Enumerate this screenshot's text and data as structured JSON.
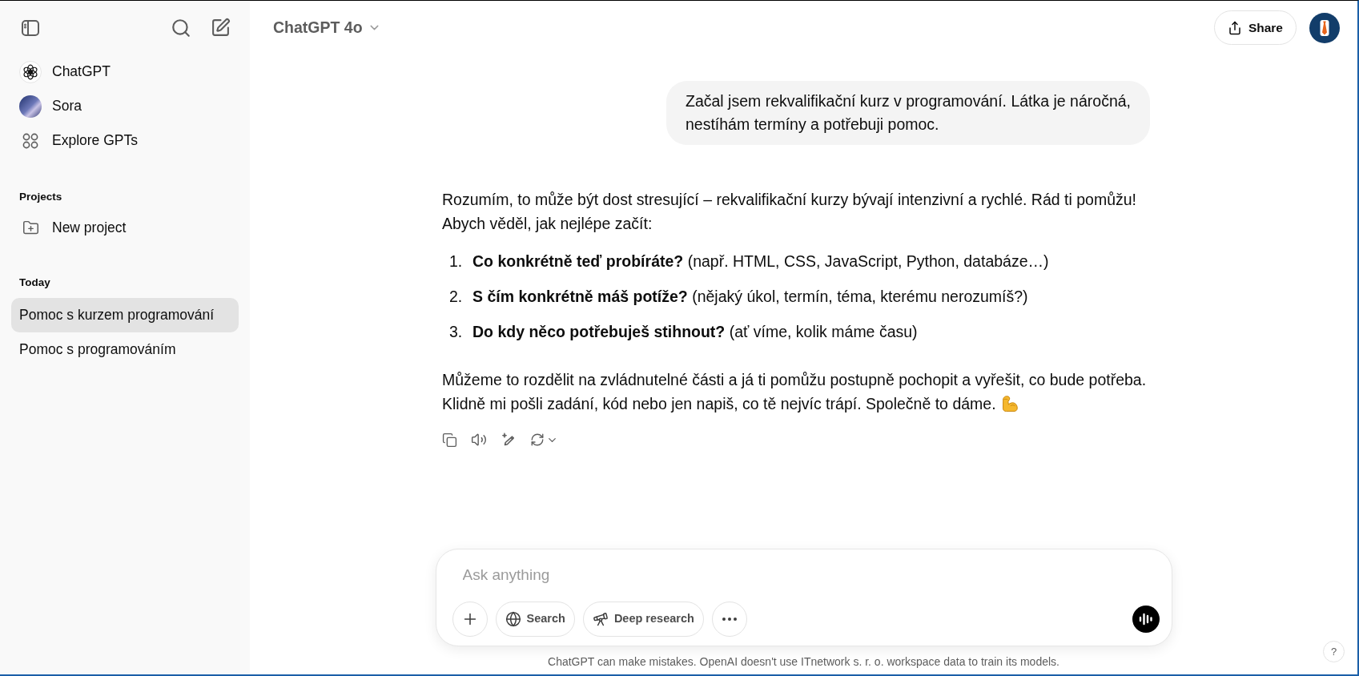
{
  "sidebar": {
    "nav_items": [
      {
        "kind": "chatgpt",
        "label": "ChatGPT"
      },
      {
        "kind": "sora",
        "label": "Sora"
      },
      {
        "kind": "explore",
        "label": "Explore GPTs"
      }
    ],
    "projects": {
      "heading": "Projects",
      "new_project": "New project"
    },
    "history": {
      "heading": "Today",
      "items": [
        {
          "label": "Pomoc s kurzem programování",
          "selected": true
        },
        {
          "label": "Pomoc s programováním",
          "selected": false
        }
      ]
    }
  },
  "header": {
    "model": "ChatGPT 4o",
    "share": "Share"
  },
  "messages": [
    {
      "kind": "user",
      "text": "Začal jsem rekvalifikační kurz v programování. Látka je náročná,\nnestíhám termíny a potřebuji pomoc."
    },
    {
      "kind": "assistant",
      "blocks": [
        {
          "kind": "paragraph",
          "text": "Rozumím, to může být dost stresující – rekvalifikační kurzy bývají intenzivní a rychlé. Rád ti pomůžu!\nAbych věděl, jak nejlépe začít:"
        },
        {
          "kind": "list",
          "items": [
            {
              "number": "1.",
              "text": "**Co konkrétně teď probíráte?** (např. HTML, CSS, JavaScript, Python, databáze…)"
            },
            {
              "number": "2.",
              "text": "**S čím konkrétně máš potíže?** (nějaký úkol, termín, téma, kterému nerozumíš?)"
            },
            {
              "number": "3.",
              "text": "**Do kdy něco potřebuješ stihnout?** (ať víme, kolik máme času)"
            }
          ]
        },
        {
          "kind": "paragraph",
          "text": "Můžeme to rozdělit na zvládnutelné části a já ti pomůžu postupně pochopit a vyřešit, co bude potřeba.\nKlidně mi pošli zadání, kód nebo jen napiš, co tě nejvíc trápí. Společně to dáme."
        }
      ]
    }
  ],
  "composer": {
    "placeholder": "Ask anything",
    "tools": [
      {
        "kind": "search",
        "label": "Search"
      },
      {
        "kind": "research",
        "label": "Deep research"
      }
    ]
  },
  "disclaimer": "ChatGPT can make mistakes. OpenAI doesn't use ITnetwork s. r. o. workspace data to train its models.",
  "help": "?"
}
